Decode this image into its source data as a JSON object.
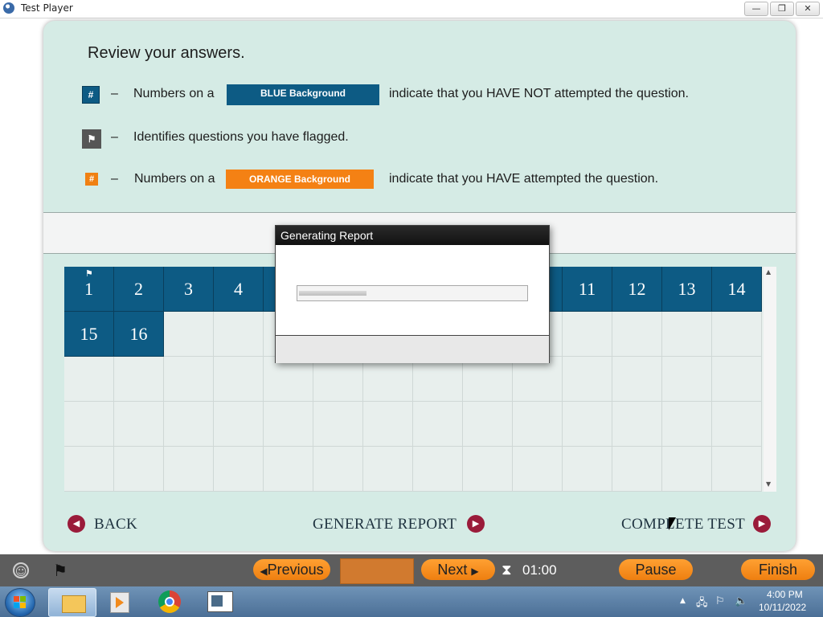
{
  "window": {
    "title": "Test Player",
    "minimize": "—",
    "restore": "❐",
    "close": "✕"
  },
  "review": {
    "title": "Review your answers.",
    "dash": "–",
    "legend_blue_chip": "#",
    "legend_blue_prefix": "Numbers on a",
    "legend_blue_label": "BLUE Background",
    "legend_blue_suffix": "indicate that you HAVE NOT attempted the question.",
    "legend_flag_text": "Identifies questions you have flagged.",
    "legend_orange_chip": "#",
    "legend_orange_prefix": "Numbers on a",
    "legend_orange_label": "ORANGE Background",
    "legend_orange_suffix": "indicate that you HAVE attempted the question.",
    "colors": {
      "blue": "#0d5b84",
      "orange": "#f48114",
      "panel": "#d5ebe5"
    }
  },
  "grid": {
    "row1": [
      "1",
      "2",
      "3",
      "4",
      "",
      "",
      "",
      "",
      "",
      "",
      "11",
      "12",
      "13",
      "14"
    ],
    "row2": [
      "15",
      "16"
    ],
    "flagged_question": "1"
  },
  "nav": {
    "back": "BACK",
    "generate_report": "GENERATE REPORT",
    "complete_test": "COMPLETE TEST"
  },
  "modal": {
    "title": "Generating Report",
    "progress": 0.3
  },
  "player": {
    "previous": "Previous",
    "next": "Next",
    "timer": "01:00",
    "pause": "Pause",
    "finish": "Finish"
  },
  "taskbar": {
    "time": "4:00 PM",
    "date": "10/11/2022"
  }
}
